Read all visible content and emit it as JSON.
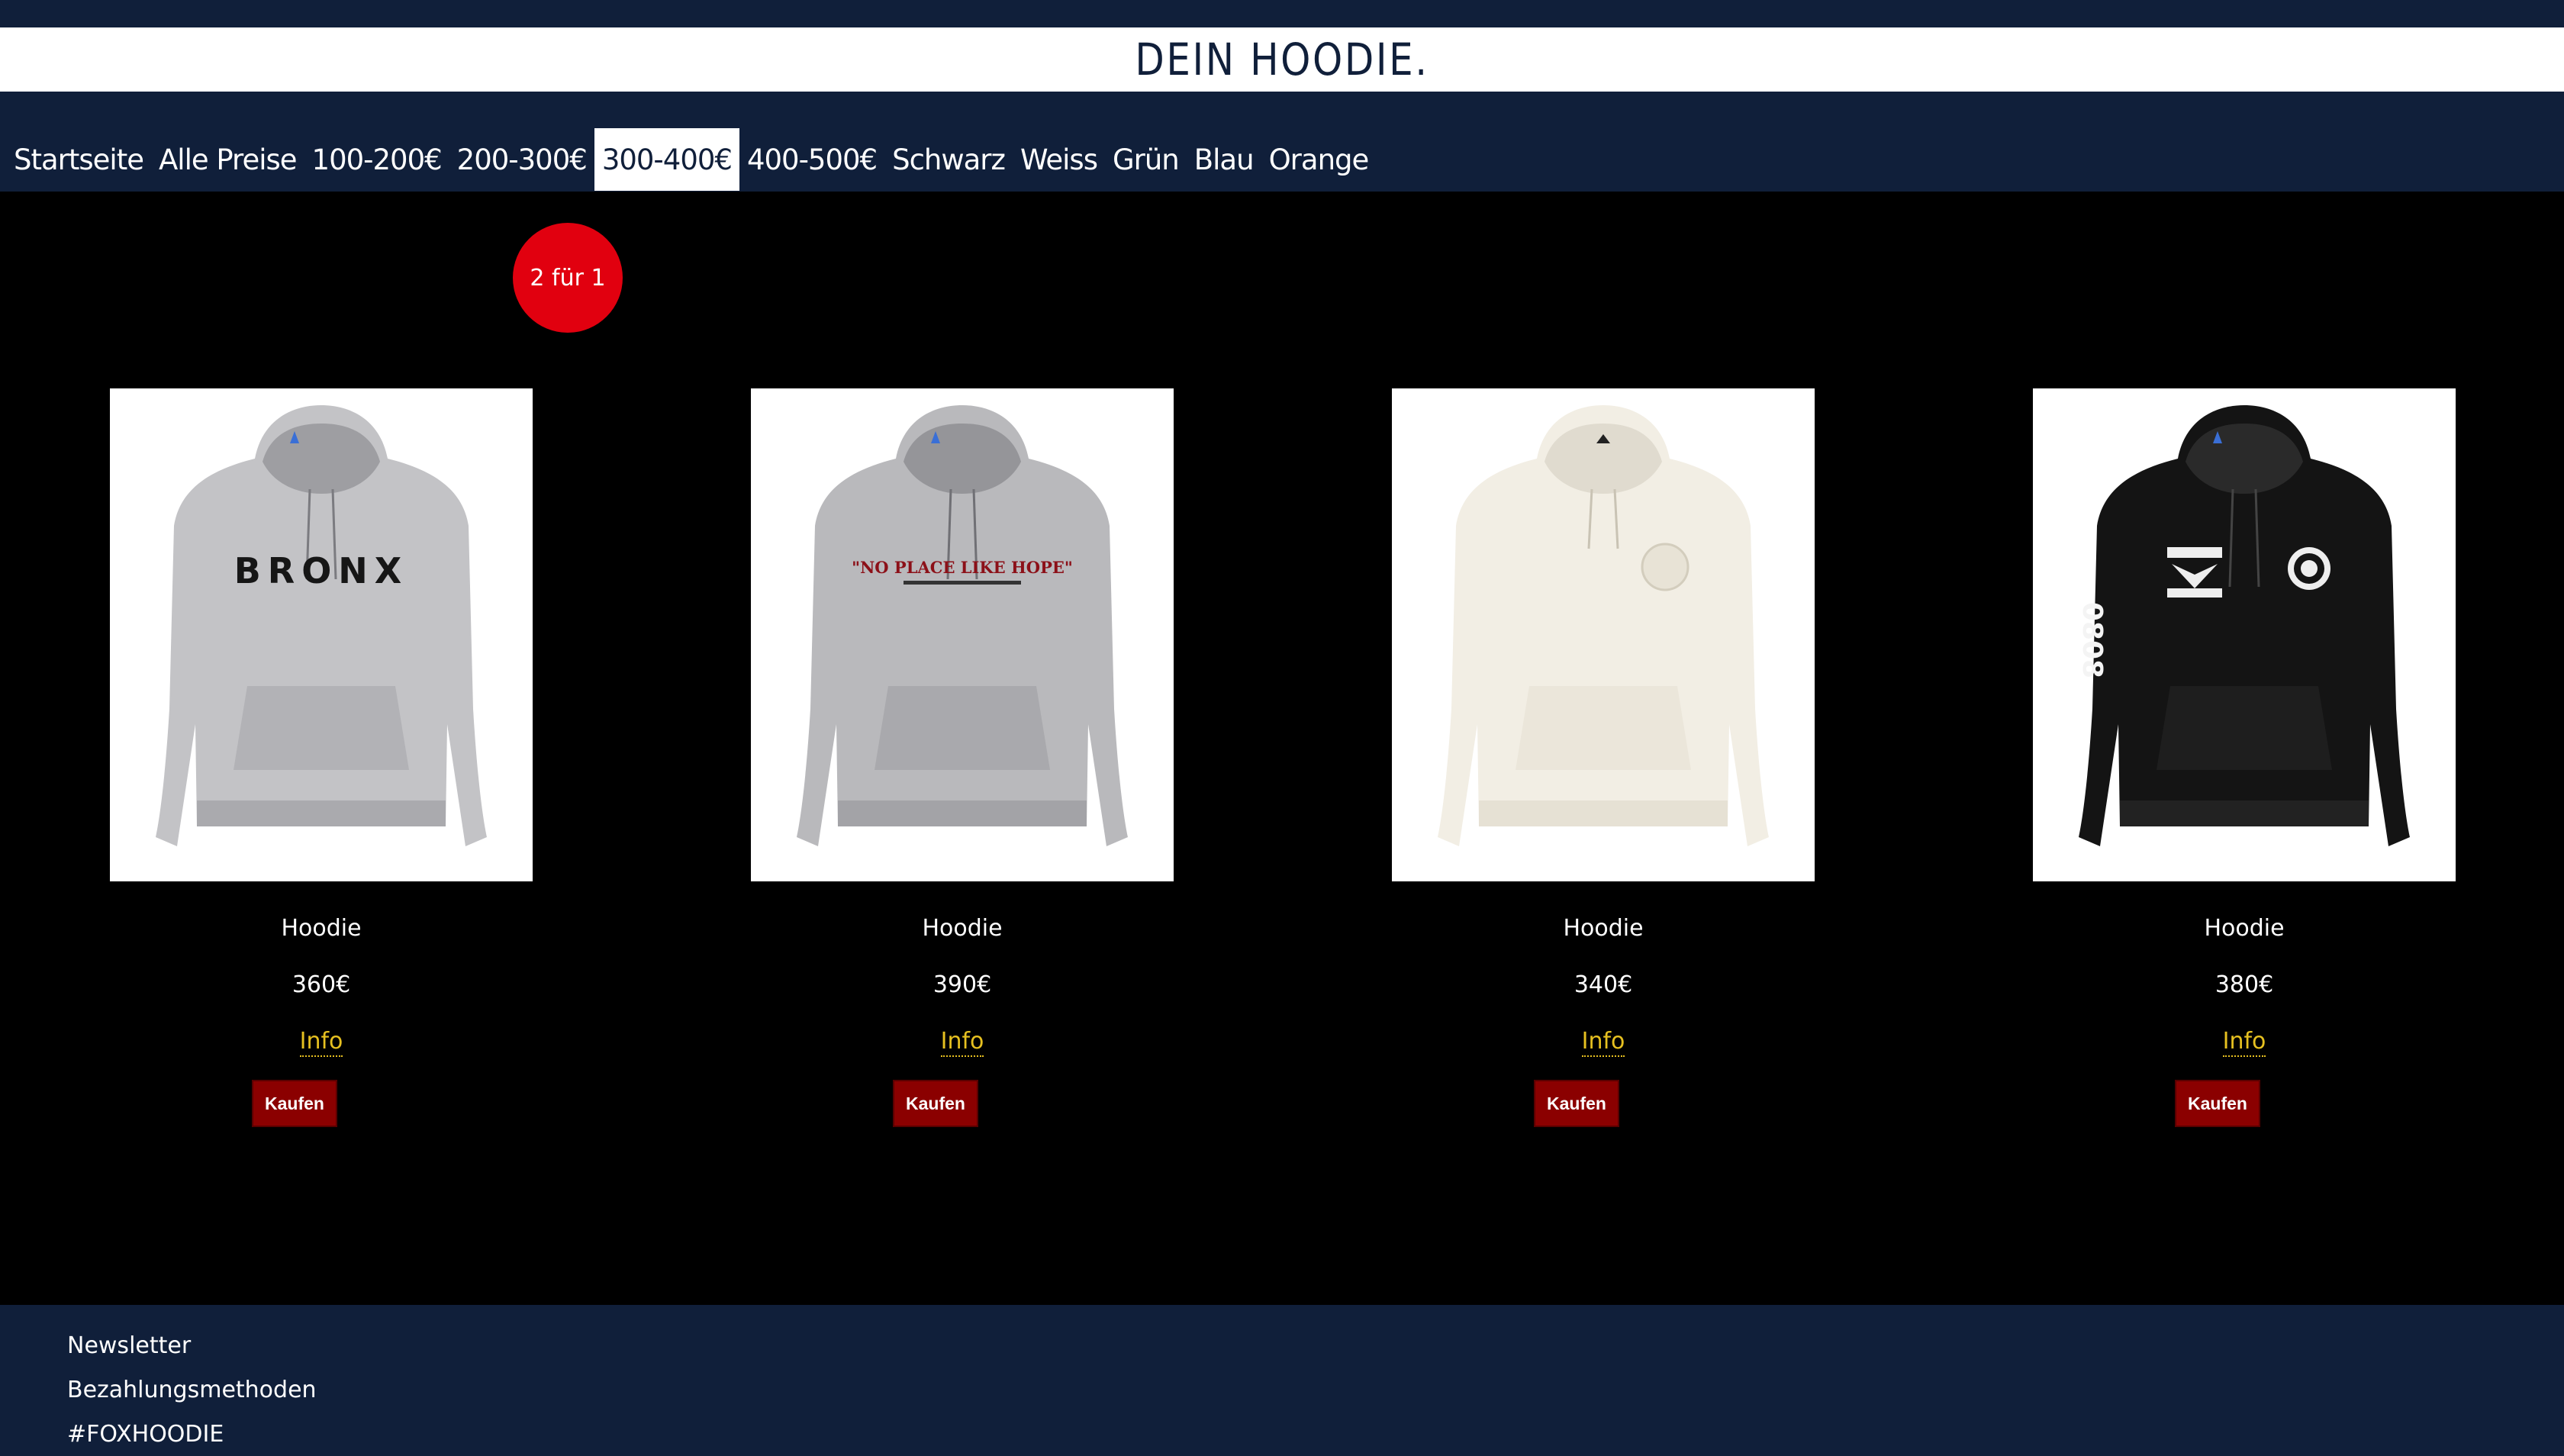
{
  "header": {
    "title": "DEIN HOODIE."
  },
  "nav": {
    "items": [
      {
        "label": "Startseite"
      },
      {
        "label": "Alle Preise"
      },
      {
        "label": "100-200€"
      },
      {
        "label": "200-300€"
      },
      {
        "label": "300-400€",
        "active": true
      },
      {
        "label": "400-500€"
      },
      {
        "label": "Schwarz"
      },
      {
        "label": "Weiss"
      },
      {
        "label": "Grün"
      },
      {
        "label": "Blau"
      },
      {
        "label": "Orange"
      }
    ]
  },
  "promo": {
    "label": "2 für 1"
  },
  "products": [
    {
      "name": "Hoodie",
      "price": "360€",
      "info": "Info",
      "buy": "Kaufen",
      "image_text": "BRONX"
    },
    {
      "name": "Hoodie",
      "price": "390€",
      "info": "Info",
      "buy": "Kaufen",
      "image_text": "\"NO PLACE LIKE HOPE\""
    },
    {
      "name": "Hoodie",
      "price": "340€",
      "info": "Info",
      "buy": "Kaufen",
      "image_text": ""
    },
    {
      "name": "Hoodie",
      "price": "380€",
      "info": "Info",
      "buy": "Kaufen",
      "image_text": "0808"
    }
  ],
  "footer": {
    "links": [
      "Newsletter",
      "Bezahlungsmethoden",
      "#FOXHOODIE"
    ]
  },
  "colors": {
    "navy": "#101f3a",
    "promo_red": "#e1000f",
    "buy_red": "#8b0000",
    "info_yellow": "#e6c020"
  }
}
